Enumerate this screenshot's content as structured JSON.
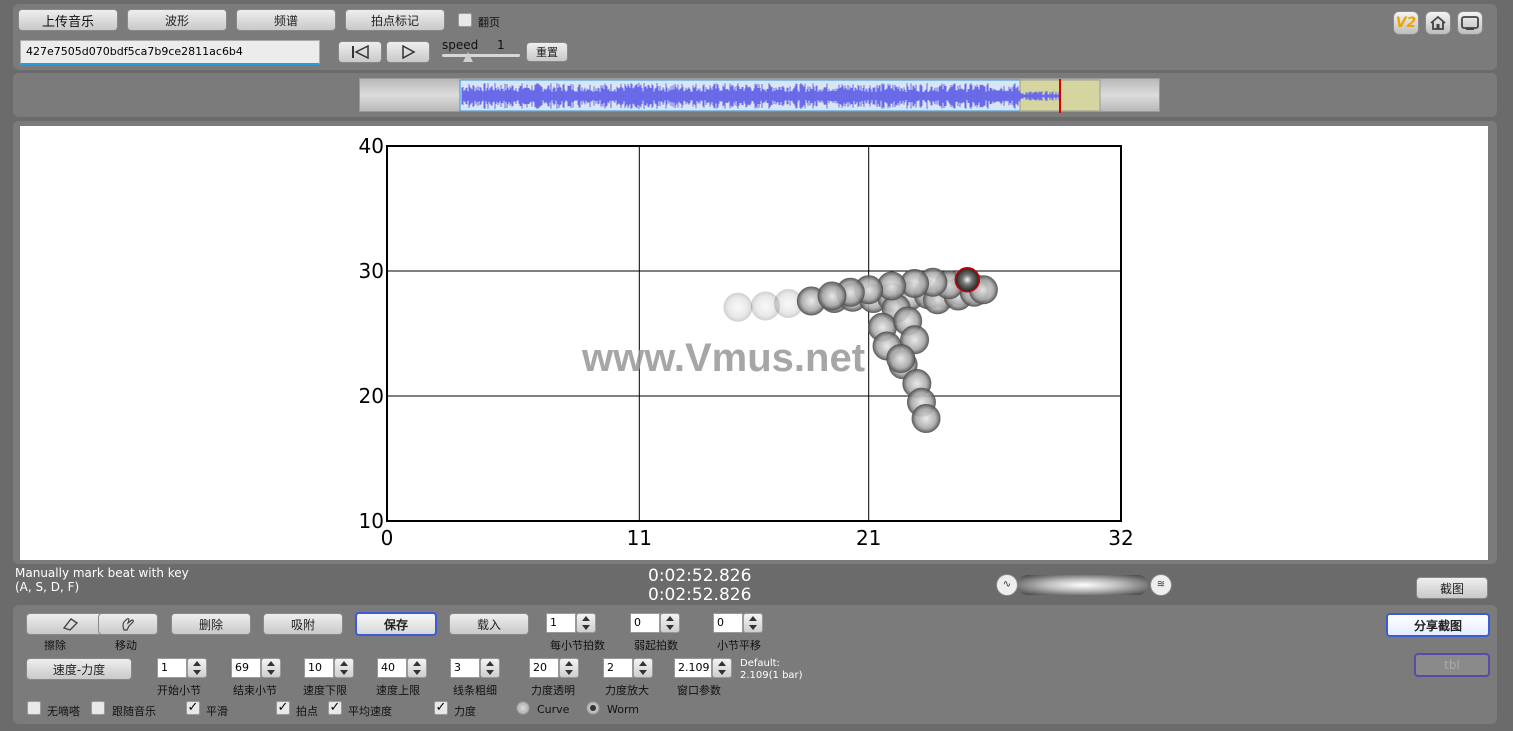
{
  "toolbar": {
    "upload": "上传音乐",
    "waveform": "波形",
    "spectrum": "频谱",
    "beat_mark": "拍点标记",
    "page_turn": "翻页",
    "file_id": "427e7505d070bdf5ca7b9ce2811ac6b4",
    "speed_label": "speed",
    "speed_value": "1",
    "reset": "重置"
  },
  "top_right": {
    "v2": "V2"
  },
  "status": {
    "hint_line1": "Manually mark beat with key",
    "hint_line2": "(A, S, D, F)",
    "time1": "0:02:52.826",
    "time2": "0:02:52.826",
    "screenshot_btn": "截图"
  },
  "watermark": "www.Vmus.net",
  "chart_data": {
    "type": "scatter",
    "xlim": [
      0,
      32
    ],
    "ylim": [
      10,
      40
    ],
    "x_ticks": [
      "0",
      "11",
      "21",
      "32"
    ],
    "y_ticks": [
      "40",
      "30",
      "20",
      "10"
    ],
    "grid": true,
    "x": [
      15.3,
      16.5,
      17.5,
      18.5,
      19.5,
      20.3,
      21.2,
      22.0,
      22.8,
      23.6,
      24.3,
      25.0,
      25.6,
      22.2,
      21.6,
      21.8,
      22.5,
      23.1,
      23.3,
      23.5,
      22.7,
      23.0,
      22.4,
      24.0,
      24.9,
      25.6,
      26.0,
      24.5,
      23.8,
      23.0,
      22.0,
      21.0,
      20.2,
      19.4,
      25.3
    ],
    "y": [
      27.1,
      27.2,
      27.4,
      27.6,
      27.8,
      27.9,
      27.8,
      27.9,
      28.0,
      28.1,
      28.2,
      28.4,
      28.6,
      27.0,
      25.5,
      24.0,
      22.5,
      21.0,
      19.5,
      18.2,
      26.0,
      24.5,
      23.0,
      27.7,
      28.0,
      28.3,
      28.5,
      28.9,
      29.1,
      29.0,
      28.8,
      28.5,
      28.3,
      28.0,
      29.3
    ]
  },
  "controls": {
    "erase": "擦除",
    "move": "移动",
    "delete": "删除",
    "snap": "吸附",
    "save": "保存",
    "load": "载入",
    "beats_per_bar_label": "每小节拍数",
    "beats_per_bar": "1",
    "pickup_label": "弱起拍数",
    "pickup": "0",
    "bar_shift_label": "小节平移",
    "bar_shift": "0",
    "share": "分享截图",
    "tempo_dynamics": "速度-力度",
    "start_bar_label": "开始小节",
    "start_bar": "1",
    "end_bar_label": "结束小节",
    "end_bar": "69",
    "tempo_min_label": "速度下限",
    "tempo_min": "10",
    "tempo_max_label": "速度上限",
    "tempo_max": "40",
    "line_width_label": "线条粗细",
    "line_width": "3",
    "dyn_alpha_label": "力度透明",
    "dyn_alpha": "20",
    "dyn_scale_label": "力度放大",
    "dyn_scale": "2",
    "window_label": "窗口参数",
    "window": "2.109",
    "default_line1": "Default:",
    "default_line2": "2.109(1 bar)",
    "disabled_btn": "tbl",
    "cb_no_tick": "无嘀嗒",
    "cb_follow": "跟随音乐",
    "cb_smooth": "平滑",
    "cb_beat": "拍点",
    "cb_avg_tempo": "平均速度",
    "cb_dynamics": "力度",
    "radio_curve": "Curve",
    "radio_worm": "Worm"
  }
}
